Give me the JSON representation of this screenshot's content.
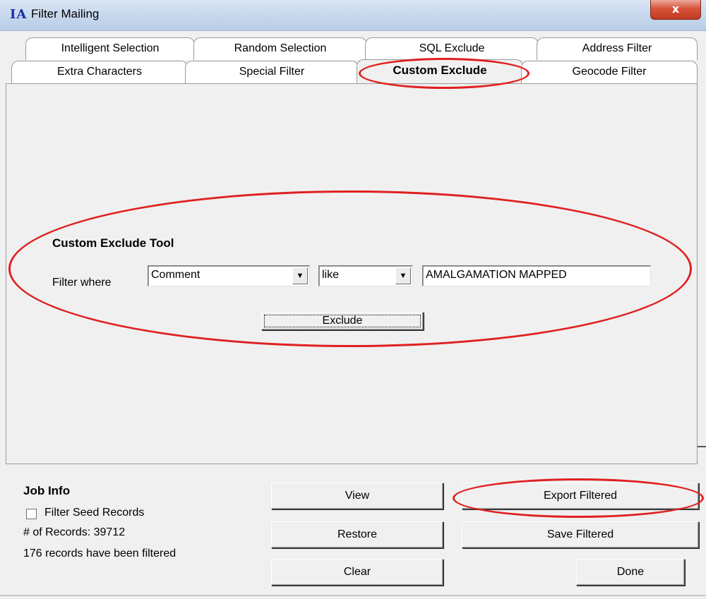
{
  "window": {
    "app_icon": "IA",
    "title": "Filter Mailing",
    "close_glyph": "x"
  },
  "tabs": {
    "row1": [
      "Intelligent Selection",
      "Random Selection",
      "SQL Exclude",
      "Address Filter"
    ],
    "row2": [
      "Extra Characters",
      "Special Filter",
      "Custom Exclude",
      "Geocode Filter"
    ],
    "active": "Custom Exclude"
  },
  "custom_exclude": {
    "tool_title": "Custom Exclude Tool",
    "filter_label": "Filter where",
    "field_value": "Comment",
    "operator_value": "like",
    "criteria_value": "AMALGAMATION MAPPED",
    "exclude_label": "Exclude"
  },
  "job_info": {
    "title": "Job Info",
    "seed_label": "Filter Seed Records",
    "seed_checked": false,
    "records_label": "# of Records: 39712",
    "filtered_text": "176 records have been filtered"
  },
  "buttons": {
    "view": "View",
    "restore": "Restore",
    "clear": "Clear",
    "export_filtered": "Export Filtered",
    "save_filtered": "Save Filtered",
    "done": "Done"
  },
  "icons": {
    "dropdown": "chevron-down-icon"
  },
  "colors": {
    "highlight": "#e02020",
    "titlebar": "#c9d9ee",
    "app_icon": "#1a2fa8"
  }
}
